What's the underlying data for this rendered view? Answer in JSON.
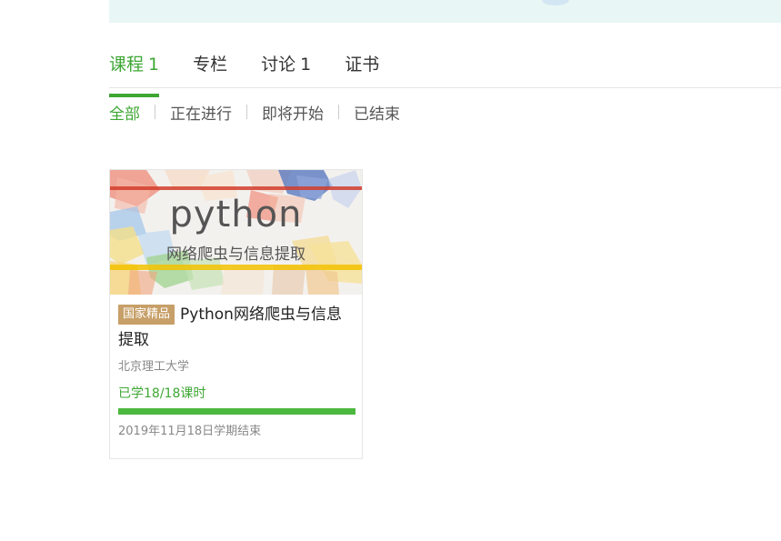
{
  "tabs": [
    {
      "label": "课程",
      "count": "1",
      "active": true
    },
    {
      "label": "专栏",
      "count": "",
      "active": false
    },
    {
      "label": "讨论",
      "count": "1",
      "active": false
    },
    {
      "label": "证书",
      "count": "",
      "active": false
    }
  ],
  "filters": [
    {
      "label": "全部",
      "active": true
    },
    {
      "label": "正在进行",
      "active": false
    },
    {
      "label": "即将开始",
      "active": false
    },
    {
      "label": "已结束",
      "active": false
    }
  ],
  "course": {
    "thumb_title": "python",
    "thumb_subtitle": "网络爬虫与信息提取",
    "badge": "国家精品",
    "name": "Python网络爬虫与信息提取",
    "school": "北京理工大学",
    "progress_text": "已学18/18课时",
    "progress_fraction": 1.0,
    "end_text": "2019年11月18日学期结束"
  },
  "colors": {
    "accent": "#3ea734",
    "badge": "#c79f68",
    "banner": "#e8f7f5"
  }
}
